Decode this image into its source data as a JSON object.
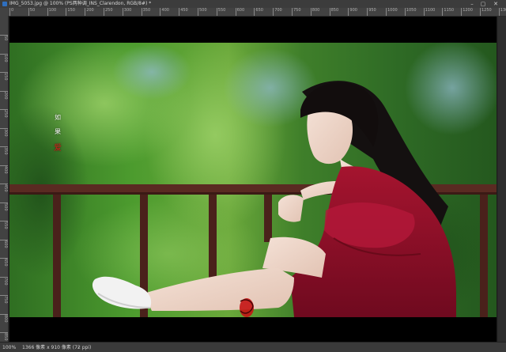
{
  "window": {
    "title": "IMG_5053.jpg @ 100% (PS两种调_INS_Clarendon, RGB/8#) *",
    "controls": {
      "minimize": "–",
      "maximize": "▢",
      "close": "✕"
    }
  },
  "ruler_top": {
    "labels": [
      "0",
      "50",
      "100",
      "150",
      "200",
      "250",
      "300",
      "350",
      "400",
      "450",
      "500",
      "550",
      "600",
      "650",
      "700",
      "750",
      "800",
      "850",
      "900",
      "950",
      "1000",
      "1050",
      "1100",
      "1150",
      "1200",
      "1250",
      "1300"
    ]
  },
  "ruler_left": {
    "labels": [
      "50",
      "100",
      "150",
      "200",
      "250",
      "300",
      "350",
      "400",
      "450",
      "500",
      "550",
      "600",
      "650",
      "700",
      "750",
      "800",
      "850"
    ]
  },
  "image": {
    "caption_glyphs": [
      "如",
      "果",
      "爱"
    ],
    "seal_glyph": "印"
  },
  "statusbar": {
    "zoom": "100%",
    "doc_size": "1366 像素 x 910 像素 (72 ppi)",
    "arrow": "›"
  },
  "colors": {
    "app_bg": "#282828",
    "panel": "#3c3c3c",
    "foliage": "#3f8a2a",
    "railing": "#5a2a22",
    "dress": "#8e0f2a",
    "seal_red": "#c41414"
  }
}
